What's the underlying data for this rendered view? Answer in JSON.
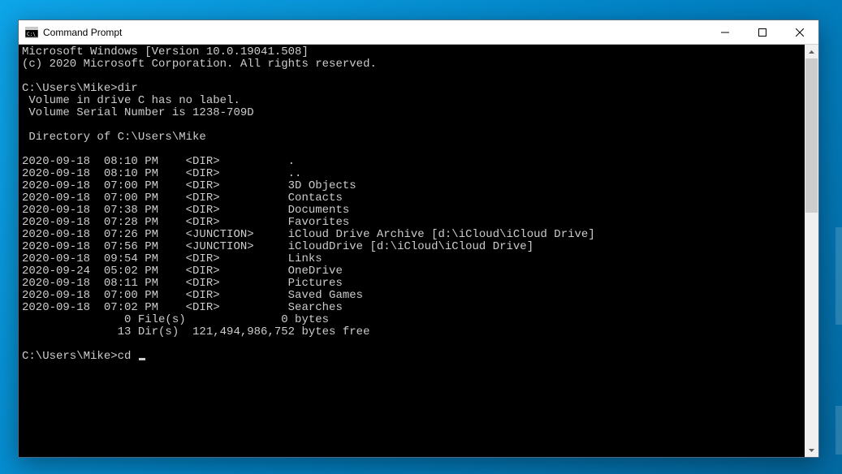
{
  "window": {
    "title": "Command Prompt"
  },
  "terminal": {
    "banner_line1": "Microsoft Windows [Version 10.0.19041.508]",
    "banner_line2": "(c) 2020 Microsoft Corporation. All rights reserved.",
    "prompt1_path": "C:\\Users\\Mike>",
    "prompt1_cmd": "dir",
    "volume_line1": " Volume in drive C has no label.",
    "volume_line2": " Volume Serial Number is 1238-709D",
    "dir_of": " Directory of C:\\Users\\Mike",
    "entries": [
      {
        "date": "2020-09-18",
        "time": "08:10 PM",
        "type": "<DIR>",
        "name": "."
      },
      {
        "date": "2020-09-18",
        "time": "08:10 PM",
        "type": "<DIR>",
        "name": ".."
      },
      {
        "date": "2020-09-18",
        "time": "07:00 PM",
        "type": "<DIR>",
        "name": "3D Objects"
      },
      {
        "date": "2020-09-18",
        "time": "07:00 PM",
        "type": "<DIR>",
        "name": "Contacts"
      },
      {
        "date": "2020-09-18",
        "time": "07:38 PM",
        "type": "<DIR>",
        "name": "Documents"
      },
      {
        "date": "2020-09-18",
        "time": "07:28 PM",
        "type": "<DIR>",
        "name": "Favorites"
      },
      {
        "date": "2020-09-18",
        "time": "07:26 PM",
        "type": "<JUNCTION>",
        "name": "iCloud Drive Archive [d:\\iCloud\\iCloud Drive]"
      },
      {
        "date": "2020-09-18",
        "time": "07:56 PM",
        "type": "<JUNCTION>",
        "name": "iCloudDrive [d:\\iCloud\\iCloud Drive]"
      },
      {
        "date": "2020-09-18",
        "time": "09:54 PM",
        "type": "<DIR>",
        "name": "Links"
      },
      {
        "date": "2020-09-24",
        "time": "05:02 PM",
        "type": "<DIR>",
        "name": "OneDrive"
      },
      {
        "date": "2020-09-18",
        "time": "08:11 PM",
        "type": "<DIR>",
        "name": "Pictures"
      },
      {
        "date": "2020-09-18",
        "time": "07:00 PM",
        "type": "<DIR>",
        "name": "Saved Games"
      },
      {
        "date": "2020-09-18",
        "time": "07:02 PM",
        "type": "<DIR>",
        "name": "Searches"
      }
    ],
    "summary_files": "               0 File(s)              0 bytes",
    "summary_dirs": "              13 Dir(s)  121,494,986,752 bytes free",
    "prompt2_path": "C:\\Users\\Mike>",
    "prompt2_cmd": "cd "
  }
}
